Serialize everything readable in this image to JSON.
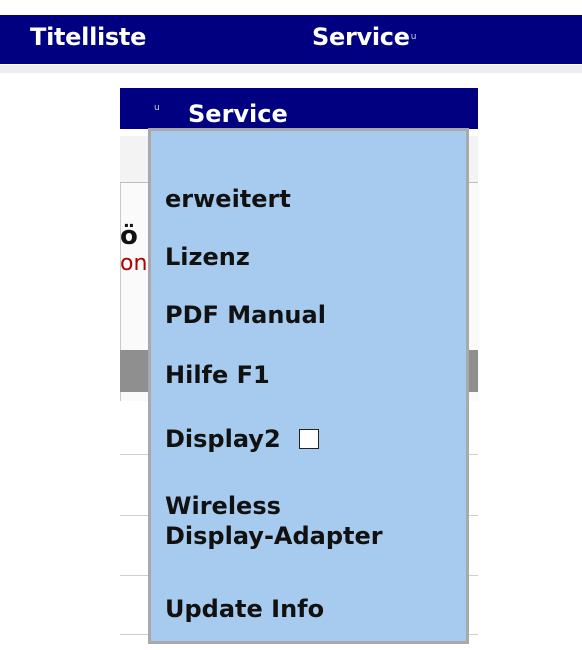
{
  "menubar": {
    "titelliste": "Titelliste",
    "service": "Service",
    "service_shortcut": "u"
  },
  "background": {
    "header_label": "Service",
    "header_shortcut": "u",
    "partial_text_1": "ö",
    "partial_text_2": "on"
  },
  "dropdown": {
    "items": [
      {
        "label": "erweitert"
      },
      {
        "label": "Lizenz"
      },
      {
        "label": "PDF Manual"
      },
      {
        "label": "Hilfe F1"
      },
      {
        "label": "Display2",
        "checkbox": false
      },
      {
        "label_line1": "Wireless",
        "label_line2": "Display-Adapter"
      },
      {
        "label": "Update Info"
      }
    ]
  },
  "colors": {
    "menubar_bg": "#000080",
    "dropdown_bg": "#a6cbef",
    "dropdown_border": "#a9a9a9"
  }
}
